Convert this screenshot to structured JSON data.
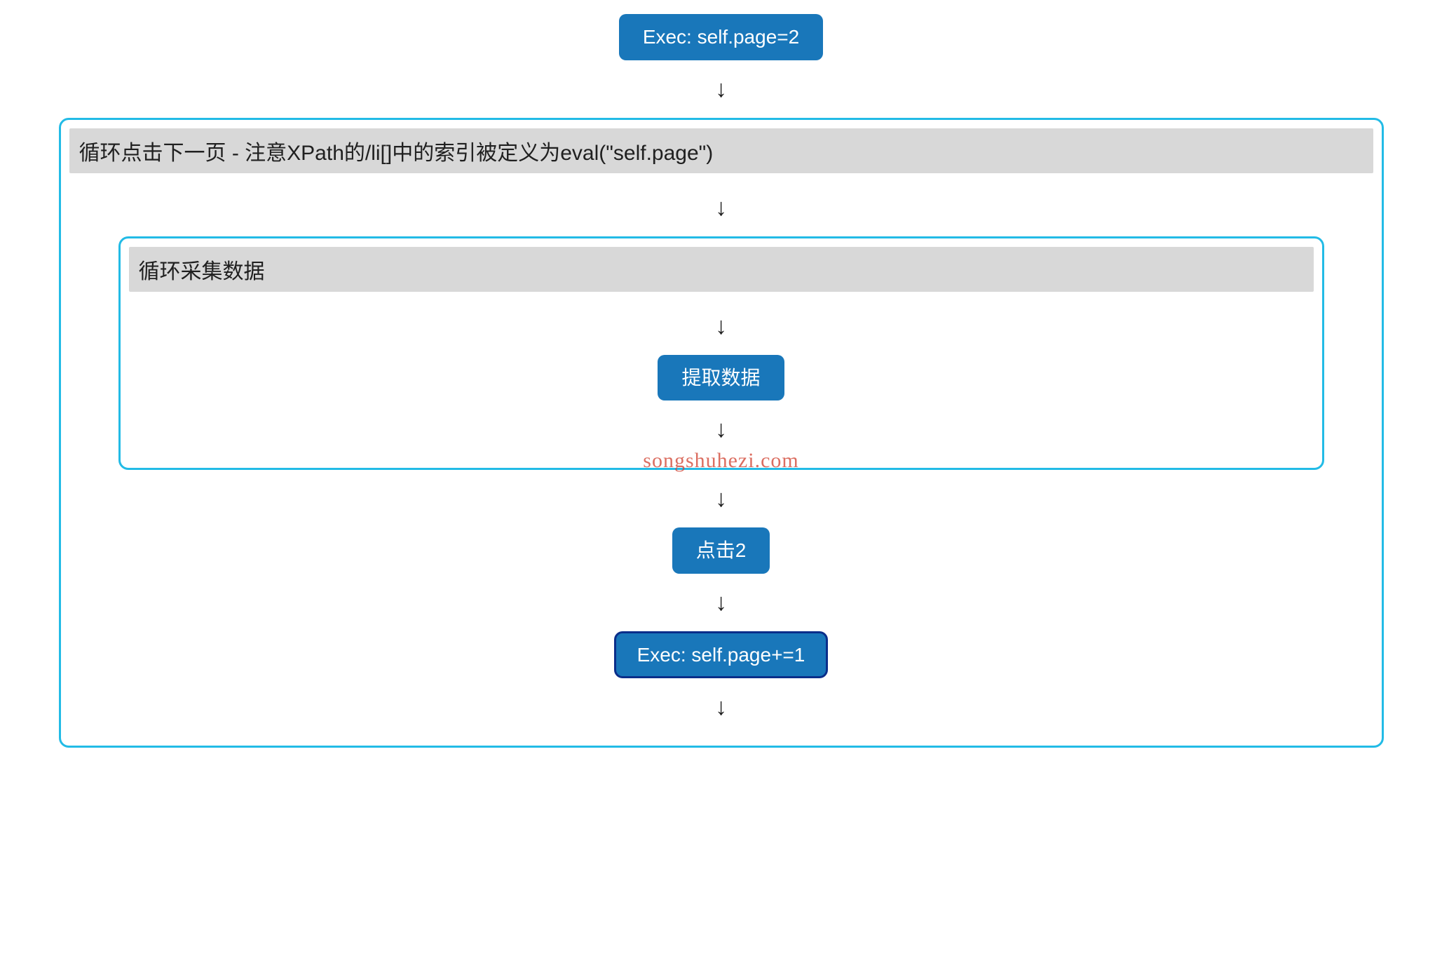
{
  "nodes": {
    "exec_init": "Exec: self.page=2",
    "loop_outer_title": "循环点击下一页 - 注意XPath的/li[]中的索引被定义为eval(\"self.page\")",
    "loop_inner_title": "循环采集数据",
    "extract": "提取数据",
    "click2": "点击2",
    "exec_inc": "Exec: self.page+=1"
  },
  "arrow_glyph": "↓",
  "watermark": "songshuhezi.com",
  "colors": {
    "node_bg": "#1977ba",
    "node_text": "#ffffff",
    "loop_border": "#22bbe6",
    "header_bg": "#d8d8d8",
    "outline": "#0a2e8a"
  }
}
